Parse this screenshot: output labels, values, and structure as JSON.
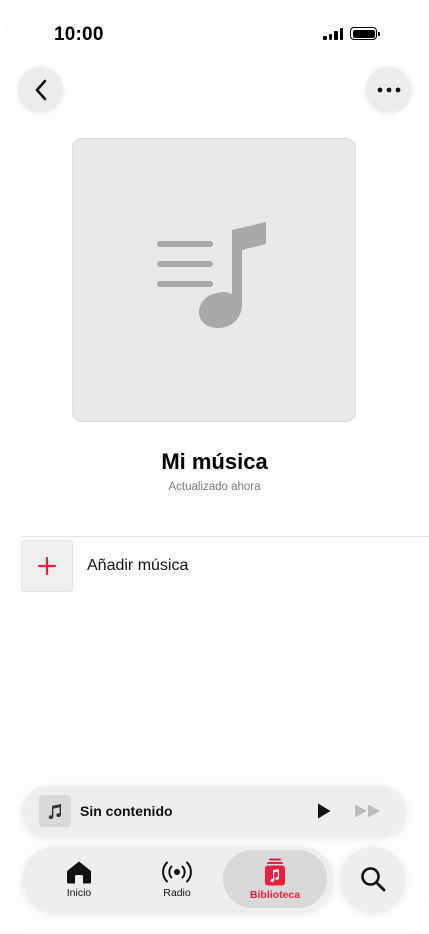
{
  "status_bar": {
    "time": "10:00"
  },
  "playlist": {
    "title": "Mi música",
    "subtitle": "Actualizado ahora",
    "add_label": "Añadir música"
  },
  "mini_player": {
    "title": "Sin contenido"
  },
  "tabs": [
    {
      "label": "Inicio",
      "icon": "home-icon"
    },
    {
      "label": "Radio",
      "icon": "radio-icon"
    },
    {
      "label": "Biblioteca",
      "icon": "library-icon",
      "selected": true
    }
  ],
  "colors": {
    "accent": "#e8203d"
  }
}
